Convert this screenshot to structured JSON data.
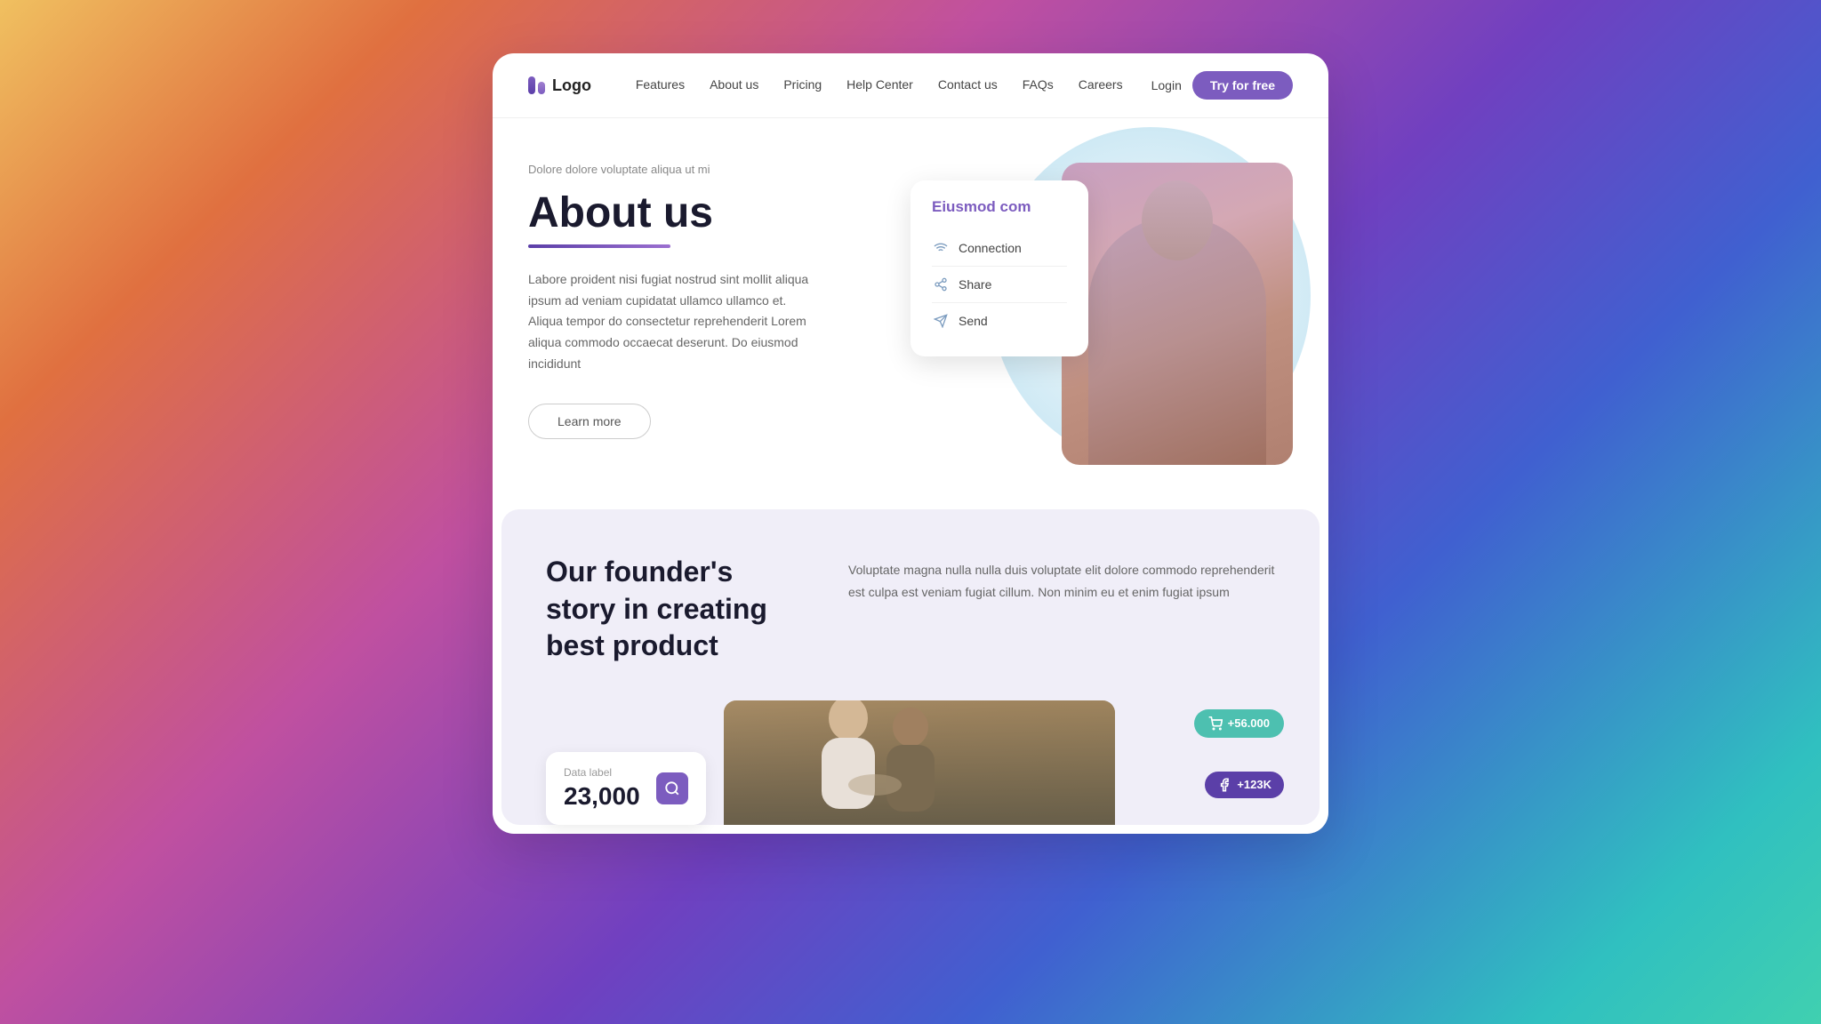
{
  "logo": {
    "text": "Logo"
  },
  "nav": {
    "links": [
      {
        "label": "Features",
        "href": "#"
      },
      {
        "label": "About us",
        "href": "#"
      },
      {
        "label": "Pricing",
        "href": "#"
      },
      {
        "label": "Help Center",
        "href": "#"
      },
      {
        "label": "Contact us",
        "href": "#"
      },
      {
        "label": "FAQs",
        "href": "#"
      },
      {
        "label": "Careers",
        "href": "#"
      }
    ],
    "login_label": "Login",
    "cta_label": "Try for free"
  },
  "hero": {
    "eyebrow": "Dolore dolore voluptate aliqua ut mi",
    "title": "About us",
    "body": "Labore proident nisi fugiat nostrud sint mollit aliqua ipsum ad veniam cupidatat ullamco ullamco et. Aliqua tempor do consectetur reprehenderit Lorem aliqua commodo occaecat deserunt. Do eiusmod incididunt",
    "cta_label": "Learn more",
    "card": {
      "title": "Eiusmod com",
      "items": [
        {
          "icon": "wifi",
          "label": "Connection"
        },
        {
          "icon": "share",
          "label": "Share"
        },
        {
          "icon": "send",
          "label": "Send"
        }
      ]
    }
  },
  "section2": {
    "title": "Our founder's story in creating best product",
    "body": "Voluptate magna nulla nulla duis voluptate elit dolore commodo reprehenderit est culpa est veniam fugiat cillum. Non minim eu et enim fugiat ipsum",
    "data_card": {
      "label": "Data label",
      "value": "23,000"
    },
    "badge_teal": "+56.000",
    "badge_purple": "+123K"
  }
}
